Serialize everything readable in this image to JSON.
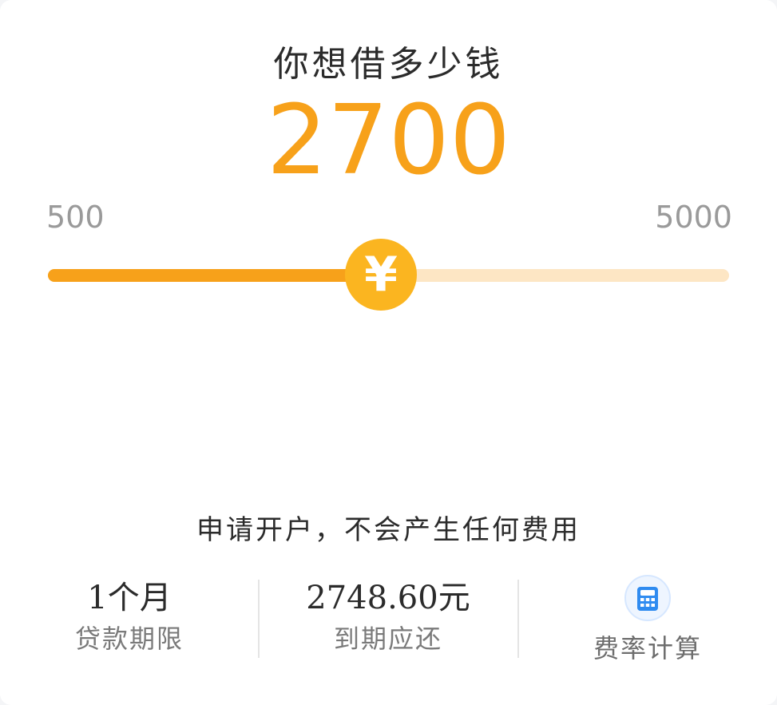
{
  "title": "你想借多少钱",
  "amount": {
    "value": "2700",
    "min_label": "500",
    "max_label": "5000",
    "min": 500,
    "max": 5000,
    "current": 2700
  },
  "slider_thumb_symbol": "¥",
  "notice": "申请开户，不会产生任何费用",
  "info": {
    "term_value": "1个月",
    "term_label": "贷款期限",
    "repay_value": "2748.60元",
    "repay_label": "到期应还",
    "calc_label": "费率计算"
  },
  "icons": {
    "slider_thumb": "yen-icon",
    "calculator": "calculator-icon"
  },
  "colors": {
    "accent": "#f7a11a",
    "thumb": "#fbb520",
    "track_bg": "#fde6c4",
    "calc_icon": "#2f8bf0"
  }
}
